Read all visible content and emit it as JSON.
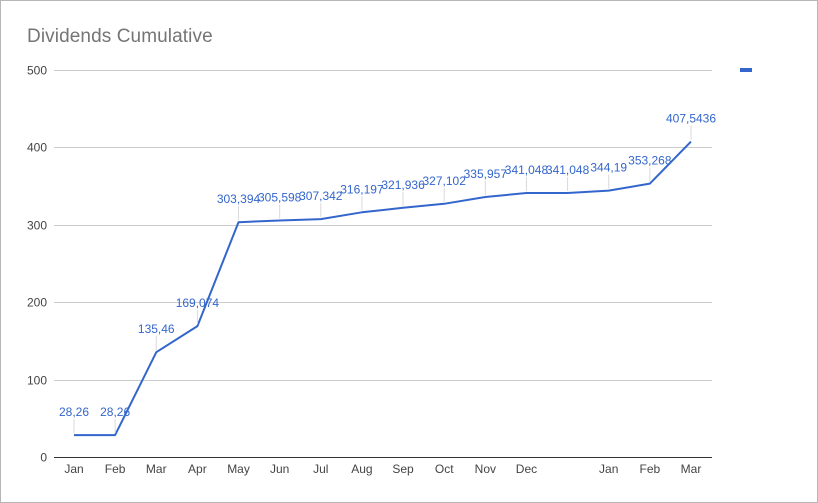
{
  "chart_data": {
    "type": "line",
    "title": "Dividends Cumulative",
    "xlabel": "",
    "ylabel": "",
    "categories": [
      "Jan",
      "Feb",
      "Mar",
      "Apr",
      "May",
      "Jun",
      "Jul",
      "Aug",
      "Sep",
      "Oct",
      "Nov",
      "Dec",
      "",
      "Jan",
      "Feb",
      "Mar"
    ],
    "series": [
      {
        "values": [
          28.26,
          28.26,
          135.46,
          169.074,
          303.394,
          305.598,
          307.342,
          316.197,
          321.936,
          327.102,
          335.957,
          341.048,
          341.048,
          344.19,
          353.268,
          407.5436
        ],
        "labels": [
          "28,26",
          "28,26",
          "135,46",
          "169,074",
          "303,394",
          "305,598",
          "307,342",
          "316,197",
          "321,936",
          "327,102",
          "335,957",
          "341,048",
          "341,048",
          "344,19",
          "353,268",
          "407,5436"
        ],
        "color": "#3366cc"
      }
    ],
    "yticks": [
      "0",
      "100",
      "200",
      "300",
      "400",
      "500"
    ],
    "ylim": [
      0,
      500
    ],
    "grid": true,
    "legend": "right",
    "colors": {
      "line": "#3366cc",
      "grid": "#cccccc",
      "axis": "#333333",
      "tick_text": "#444444",
      "title": "#757575",
      "label": "#3366cc"
    }
  }
}
